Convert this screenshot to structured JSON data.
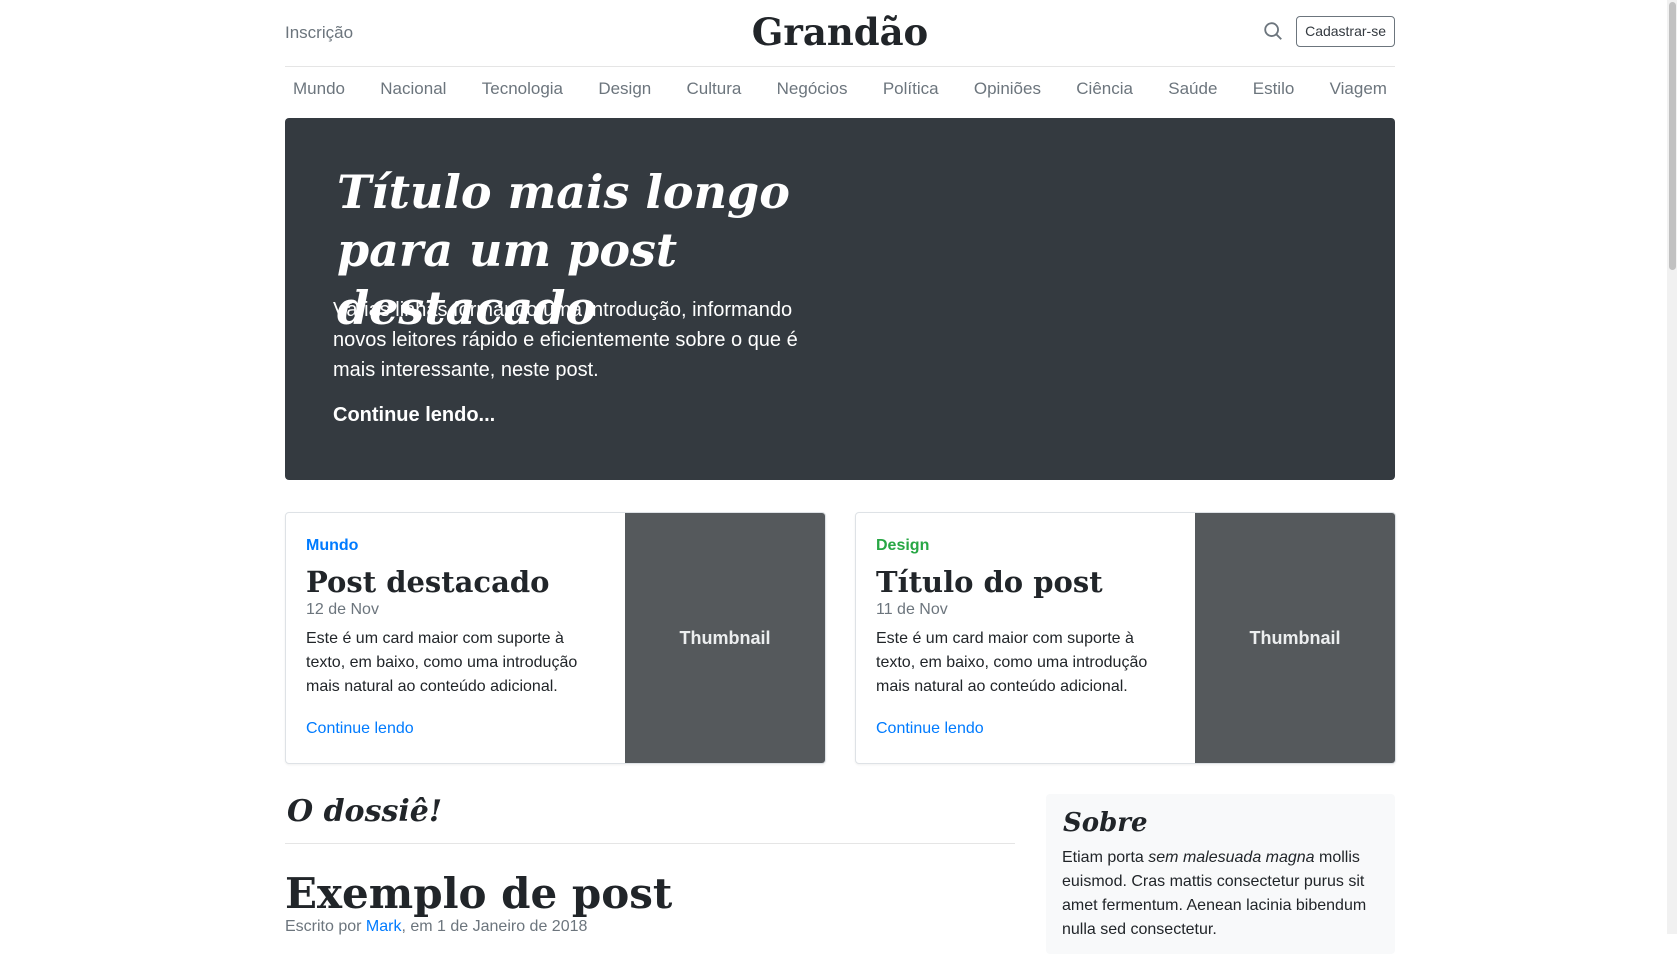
{
  "header": {
    "subscribe": "Inscrição",
    "brand": "Grandão",
    "signup": "Cadastrar-se"
  },
  "nav": [
    "Mundo",
    "Nacional",
    "Tecnologia",
    "Design",
    "Cultura",
    "Negócios",
    "Política",
    "Opiniões",
    "Ciência",
    "Saúde",
    "Estilo",
    "Viagem"
  ],
  "jumbotron": {
    "title": "Título mais longo para um post destacado",
    "lead": "Várias linhas formando uma introdução, informando novos leitores rápido e eficientemente sobre o que é mais interessante, neste post.",
    "link": "Continue lendo..."
  },
  "cards": [
    {
      "category": "Mundo",
      "category_color": "#007bff",
      "title": "Post destacado",
      "date": "12 de Nov",
      "text": "Este é um card maior com suporte à texto, em baixo, como uma introdução mais natural ao conteúdo adicional.",
      "link": "Continue lendo",
      "thumb": "Thumbnail"
    },
    {
      "category": "Design",
      "category_color": "#28a745",
      "title": "Título do post",
      "date": "11 de Nov",
      "text": "Este é um card maior com suporte à texto, em baixo, como uma introdução mais natural ao conteúdo adicional.",
      "link": "Continue lendo",
      "thumb": "Thumbnail"
    }
  ],
  "main": {
    "section_title": "O dossiê!",
    "post_title": "Exemplo de post",
    "meta_prefix": "Escrito por ",
    "meta_author": "Mark",
    "meta_suffix": ", em 1 de Janeiro de 2018"
  },
  "sidebar": {
    "about_title": "Sobre",
    "about_before": "Etiam porta ",
    "about_em": "sem malesuada magna",
    "about_after": " mollis euismod. Cras mattis consectetur purus sit amet fermentum. Aenean lacinia bibendum nulla sed consectetur."
  }
}
